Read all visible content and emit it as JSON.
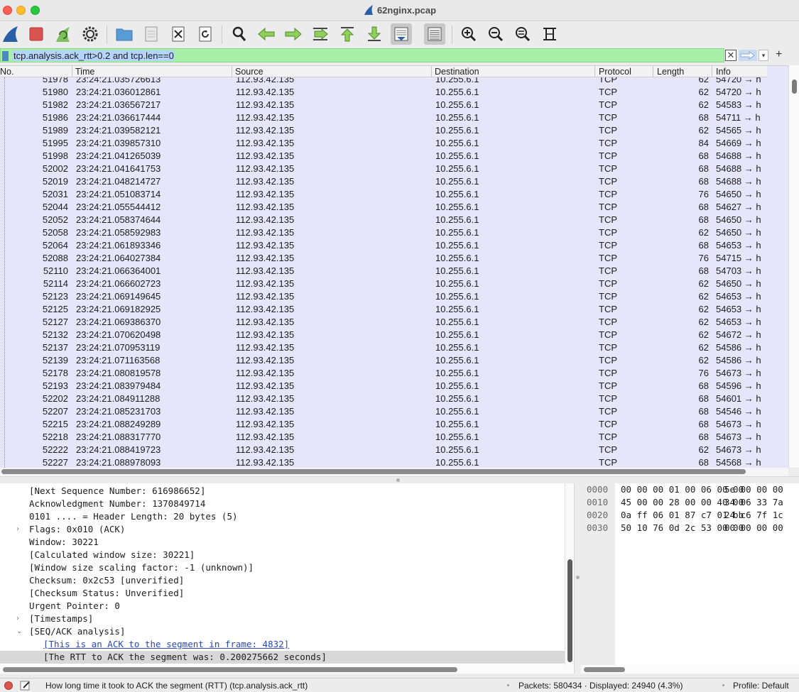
{
  "window": {
    "title": "62nginx.pcap"
  },
  "toolbar": {
    "icons": [
      "shark-fin-start-icon",
      "stop-square-icon",
      "restart-fin-icon",
      "gear-options-icon",
      "open-folder-icon",
      "save-file-icon",
      "close-file-icon",
      "reload-icon",
      "find-packet-icon",
      "back-arrow-icon",
      "forward-arrow-icon",
      "go-to-packet-icon",
      "first-packet-icon",
      "last-packet-icon",
      "autoscroll-icon",
      "colorize-icon",
      "zoom-in-icon",
      "zoom-out-icon",
      "normal-size-icon",
      "resize-columns-icon"
    ]
  },
  "filter": {
    "value": "tcp.analysis.ack_rtt>0.2 and tcp.len==0",
    "clear_glyph": "✕",
    "dropdown_glyph": "▾",
    "add_glyph": "+"
  },
  "packet_list": {
    "columns": [
      "No.",
      "Time",
      "Source",
      "Destination",
      "Protocol",
      "Length",
      "Info"
    ],
    "rows": [
      [
        "51978",
        "23:24:21.035726613",
        "112.93.42.135",
        "10.255.6.1",
        "TCP",
        "62",
        "54720 → h"
      ],
      [
        "51980",
        "23:24:21.036012861",
        "112.93.42.135",
        "10.255.6.1",
        "TCP",
        "62",
        "54720 → h"
      ],
      [
        "51982",
        "23:24:21.036567217",
        "112.93.42.135",
        "10.255.6.1",
        "TCP",
        "62",
        "54583 → h"
      ],
      [
        "51986",
        "23:24:21.036617444",
        "112.93.42.135",
        "10.255.6.1",
        "TCP",
        "68",
        "54711 → h"
      ],
      [
        "51989",
        "23:24:21.039582121",
        "112.93.42.135",
        "10.255.6.1",
        "TCP",
        "62",
        "54565 → h"
      ],
      [
        "51995",
        "23:24:21.039857310",
        "112.93.42.135",
        "10.255.6.1",
        "TCP",
        "84",
        "54669 → h"
      ],
      [
        "51998",
        "23:24:21.041265039",
        "112.93.42.135",
        "10.255.6.1",
        "TCP",
        "68",
        "54688 → h"
      ],
      [
        "52002",
        "23:24:21.041641753",
        "112.93.42.135",
        "10.255.6.1",
        "TCP",
        "68",
        "54688 → h"
      ],
      [
        "52019",
        "23:24:21.048214727",
        "112.93.42.135",
        "10.255.6.1",
        "TCP",
        "68",
        "54688 → h"
      ],
      [
        "52031",
        "23:24:21.051083714",
        "112.93.42.135",
        "10.255.6.1",
        "TCP",
        "76",
        "54650 → h"
      ],
      [
        "52044",
        "23:24:21.055544412",
        "112.93.42.135",
        "10.255.6.1",
        "TCP",
        "68",
        "54627 → h"
      ],
      [
        "52052",
        "23:24:21.058374644",
        "112.93.42.135",
        "10.255.6.1",
        "TCP",
        "68",
        "54650 → h"
      ],
      [
        "52058",
        "23:24:21.058592983",
        "112.93.42.135",
        "10.255.6.1",
        "TCP",
        "62",
        "54650 → h"
      ],
      [
        "52064",
        "23:24:21.061893346",
        "112.93.42.135",
        "10.255.6.1",
        "TCP",
        "68",
        "54653 → h"
      ],
      [
        "52088",
        "23:24:21.064027384",
        "112.93.42.135",
        "10.255.6.1",
        "TCP",
        "76",
        "54715 → h"
      ],
      [
        "52110",
        "23:24:21.066364001",
        "112.93.42.135",
        "10.255.6.1",
        "TCP",
        "68",
        "54703 → h"
      ],
      [
        "52114",
        "23:24:21.066602723",
        "112.93.42.135",
        "10.255.6.1",
        "TCP",
        "62",
        "54650 → h"
      ],
      [
        "52123",
        "23:24:21.069149645",
        "112.93.42.135",
        "10.255.6.1",
        "TCP",
        "62",
        "54653 → h"
      ],
      [
        "52125",
        "23:24:21.069182925",
        "112.93.42.135",
        "10.255.6.1",
        "TCP",
        "62",
        "54653 → h"
      ],
      [
        "52127",
        "23:24:21.069386370",
        "112.93.42.135",
        "10.255.6.1",
        "TCP",
        "62",
        "54653 → h"
      ],
      [
        "52132",
        "23:24:21.070620498",
        "112.93.42.135",
        "10.255.6.1",
        "TCP",
        "62",
        "54672 → h"
      ],
      [
        "52137",
        "23:24:21.070953119",
        "112.93.42.135",
        "10.255.6.1",
        "TCP",
        "62",
        "54586 → h"
      ],
      [
        "52139",
        "23:24:21.071163568",
        "112.93.42.135",
        "10.255.6.1",
        "TCP",
        "62",
        "54586 → h"
      ],
      [
        "52178",
        "23:24:21.080819578",
        "112.93.42.135",
        "10.255.6.1",
        "TCP",
        "76",
        "54673 → h"
      ],
      [
        "52193",
        "23:24:21.083979484",
        "112.93.42.135",
        "10.255.6.1",
        "TCP",
        "68",
        "54596 → h"
      ],
      [
        "52202",
        "23:24:21.084911288",
        "112.93.42.135",
        "10.255.6.1",
        "TCP",
        "68",
        "54601 → h"
      ],
      [
        "52207",
        "23:24:21.085231703",
        "112.93.42.135",
        "10.255.6.1",
        "TCP",
        "68",
        "54546 → h"
      ],
      [
        "52215",
        "23:24:21.088249289",
        "112.93.42.135",
        "10.255.6.1",
        "TCP",
        "68",
        "54673 → h"
      ],
      [
        "52218",
        "23:24:21.088317770",
        "112.93.42.135",
        "10.255.6.1",
        "TCP",
        "68",
        "54673 → h"
      ],
      [
        "52222",
        "23:24:21.088419723",
        "112.93.42.135",
        "10.255.6.1",
        "TCP",
        "62",
        "54673 → h"
      ],
      [
        "52227",
        "23:24:21.088978093",
        "112.93.42.135",
        "10.255.6.1",
        "TCP",
        "68",
        "54568 → h"
      ]
    ]
  },
  "details": {
    "lines": [
      {
        "text": "[Next Sequence Number: 616986652]",
        "arrow": "",
        "indent": 0,
        "link": false,
        "selected": false
      },
      {
        "text": "Acknowledgment Number: 1370849714",
        "arrow": "",
        "indent": 0,
        "link": false,
        "selected": false
      },
      {
        "text": "0101 .... = Header Length: 20 bytes (5)",
        "arrow": "",
        "indent": 0,
        "link": false,
        "selected": false
      },
      {
        "text": "Flags: 0x010 (ACK)",
        "arrow": "›",
        "indent": 0,
        "link": false,
        "selected": false
      },
      {
        "text": "Window: 30221",
        "arrow": "",
        "indent": 0,
        "link": false,
        "selected": false
      },
      {
        "text": "[Calculated window size: 30221]",
        "arrow": "",
        "indent": 0,
        "link": false,
        "selected": false
      },
      {
        "text": "[Window size scaling factor: -1 (unknown)]",
        "arrow": "",
        "indent": 0,
        "link": false,
        "selected": false
      },
      {
        "text": "Checksum: 0x2c53 [unverified]",
        "arrow": "",
        "indent": 0,
        "link": false,
        "selected": false
      },
      {
        "text": "[Checksum Status: Unverified]",
        "arrow": "",
        "indent": 0,
        "link": false,
        "selected": false
      },
      {
        "text": "Urgent Pointer: 0",
        "arrow": "",
        "indent": 0,
        "link": false,
        "selected": false
      },
      {
        "text": "[Timestamps]",
        "arrow": "›",
        "indent": 0,
        "link": false,
        "selected": false
      },
      {
        "text": "[SEQ/ACK analysis]",
        "arrow": "⌄",
        "indent": 0,
        "link": false,
        "selected": false
      },
      {
        "text": "[This is an ACK to the segment in frame: 4832]",
        "arrow": "",
        "indent": 1,
        "link": true,
        "selected": false
      },
      {
        "text": "[The RTT to ACK the segment was: 0.200275662 seconds]",
        "arrow": "",
        "indent": 1,
        "link": false,
        "selected": true
      }
    ]
  },
  "bytes": {
    "rows": [
      {
        "offset": "0000",
        "hex1": "00 00 00 01 00 06 00 00",
        "hex2": "5e 00 00 00"
      },
      {
        "offset": "0010",
        "hex1": "45 00 00 28 00 00 40 00",
        "hex2": "34 06 33 7a"
      },
      {
        "offset": "0020",
        "hex1": "0a ff 06 01 87 c7 01 bb",
        "hex2": "24 c6 7f 1c"
      },
      {
        "offset": "0030",
        "hex1": "50 10 76 0d 2c 53 00 00",
        "hex2": "00 00 00 00"
      }
    ]
  },
  "status": {
    "message": "How long time it took to ACK the segment (RTT) (tcp.analysis.ack_rtt)",
    "packets": "Packets: 580434 · Displayed: 24940 (4.3%)",
    "profile": "Profile: Default"
  }
}
